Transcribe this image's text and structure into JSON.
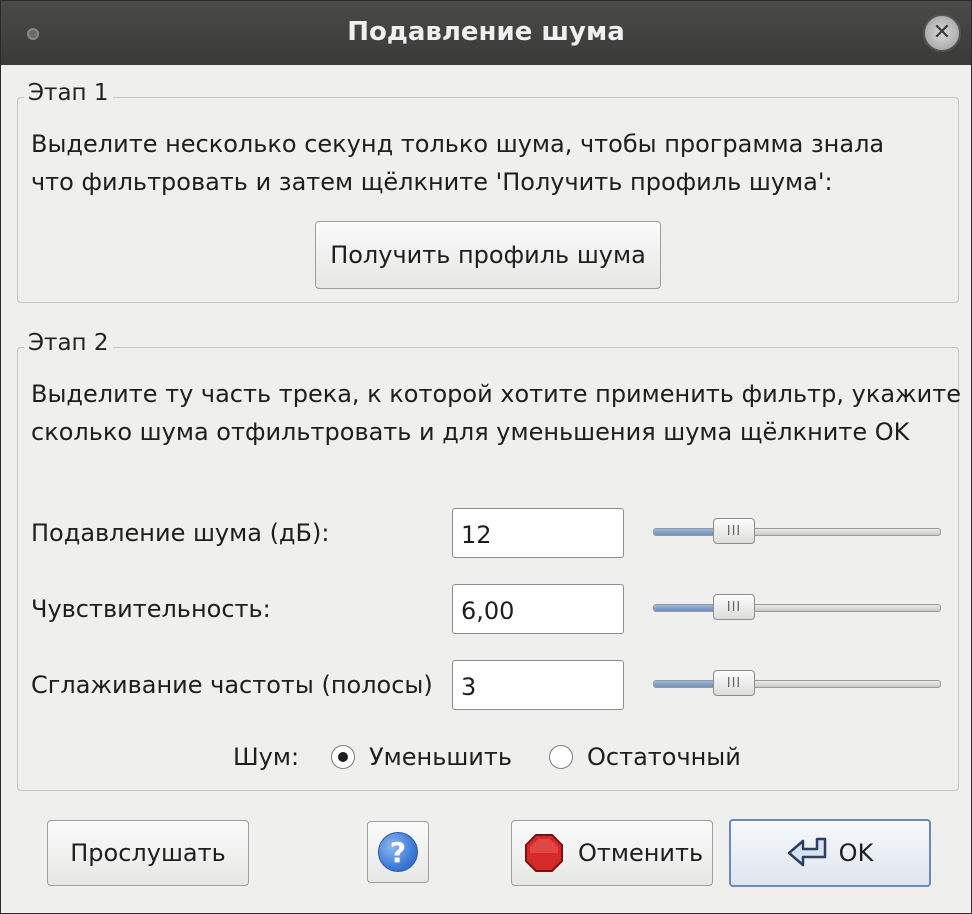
{
  "window": {
    "title": "Подавление шума",
    "close_glyph": "✕"
  },
  "step1": {
    "legend": "Этап 1",
    "line1": "Выделите несколько секунд только шума, чтобы программа знала",
    "line2": "что фильтровать и затем щёлкните 'Получить профиль шума':",
    "get_profile_label": "Получить профиль шума"
  },
  "step2": {
    "legend": "Этап 2",
    "line1": "Выделите ту часть трека, к которой хотите применить фильтр, укажите",
    "line2": "сколько шума отфильтровать и для уменьшения шума щёлкните OK",
    "params": [
      {
        "label": "Подавление шума (дБ):",
        "value": "12",
        "slider_fraction": 0.28
      },
      {
        "label": "Чувствительность:",
        "value": "6,00",
        "slider_fraction": 0.28
      },
      {
        "label": "Сглаживание частоты (полосы)",
        "value": "3",
        "slider_fraction": 0.28
      }
    ],
    "noise_label": "Шум:",
    "noise_options": [
      {
        "label": "Уменьшить",
        "checked": true
      },
      {
        "label": "Остаточный",
        "checked": false
      }
    ]
  },
  "buttons": {
    "preview_label": "Прослушать",
    "help_glyph": "?",
    "cancel_label": "Отменить",
    "ok_label": "OK"
  },
  "icons": {
    "help": "help-icon",
    "stop": "stop-icon",
    "enter": "enter-arrow-icon",
    "thumb_grip": "III"
  },
  "colors": {
    "ok_border": "#6c88b4",
    "slider_fill": "#6b8ec0",
    "stop_red": "#d42a2a",
    "help_blue": "#3e7bd6"
  }
}
